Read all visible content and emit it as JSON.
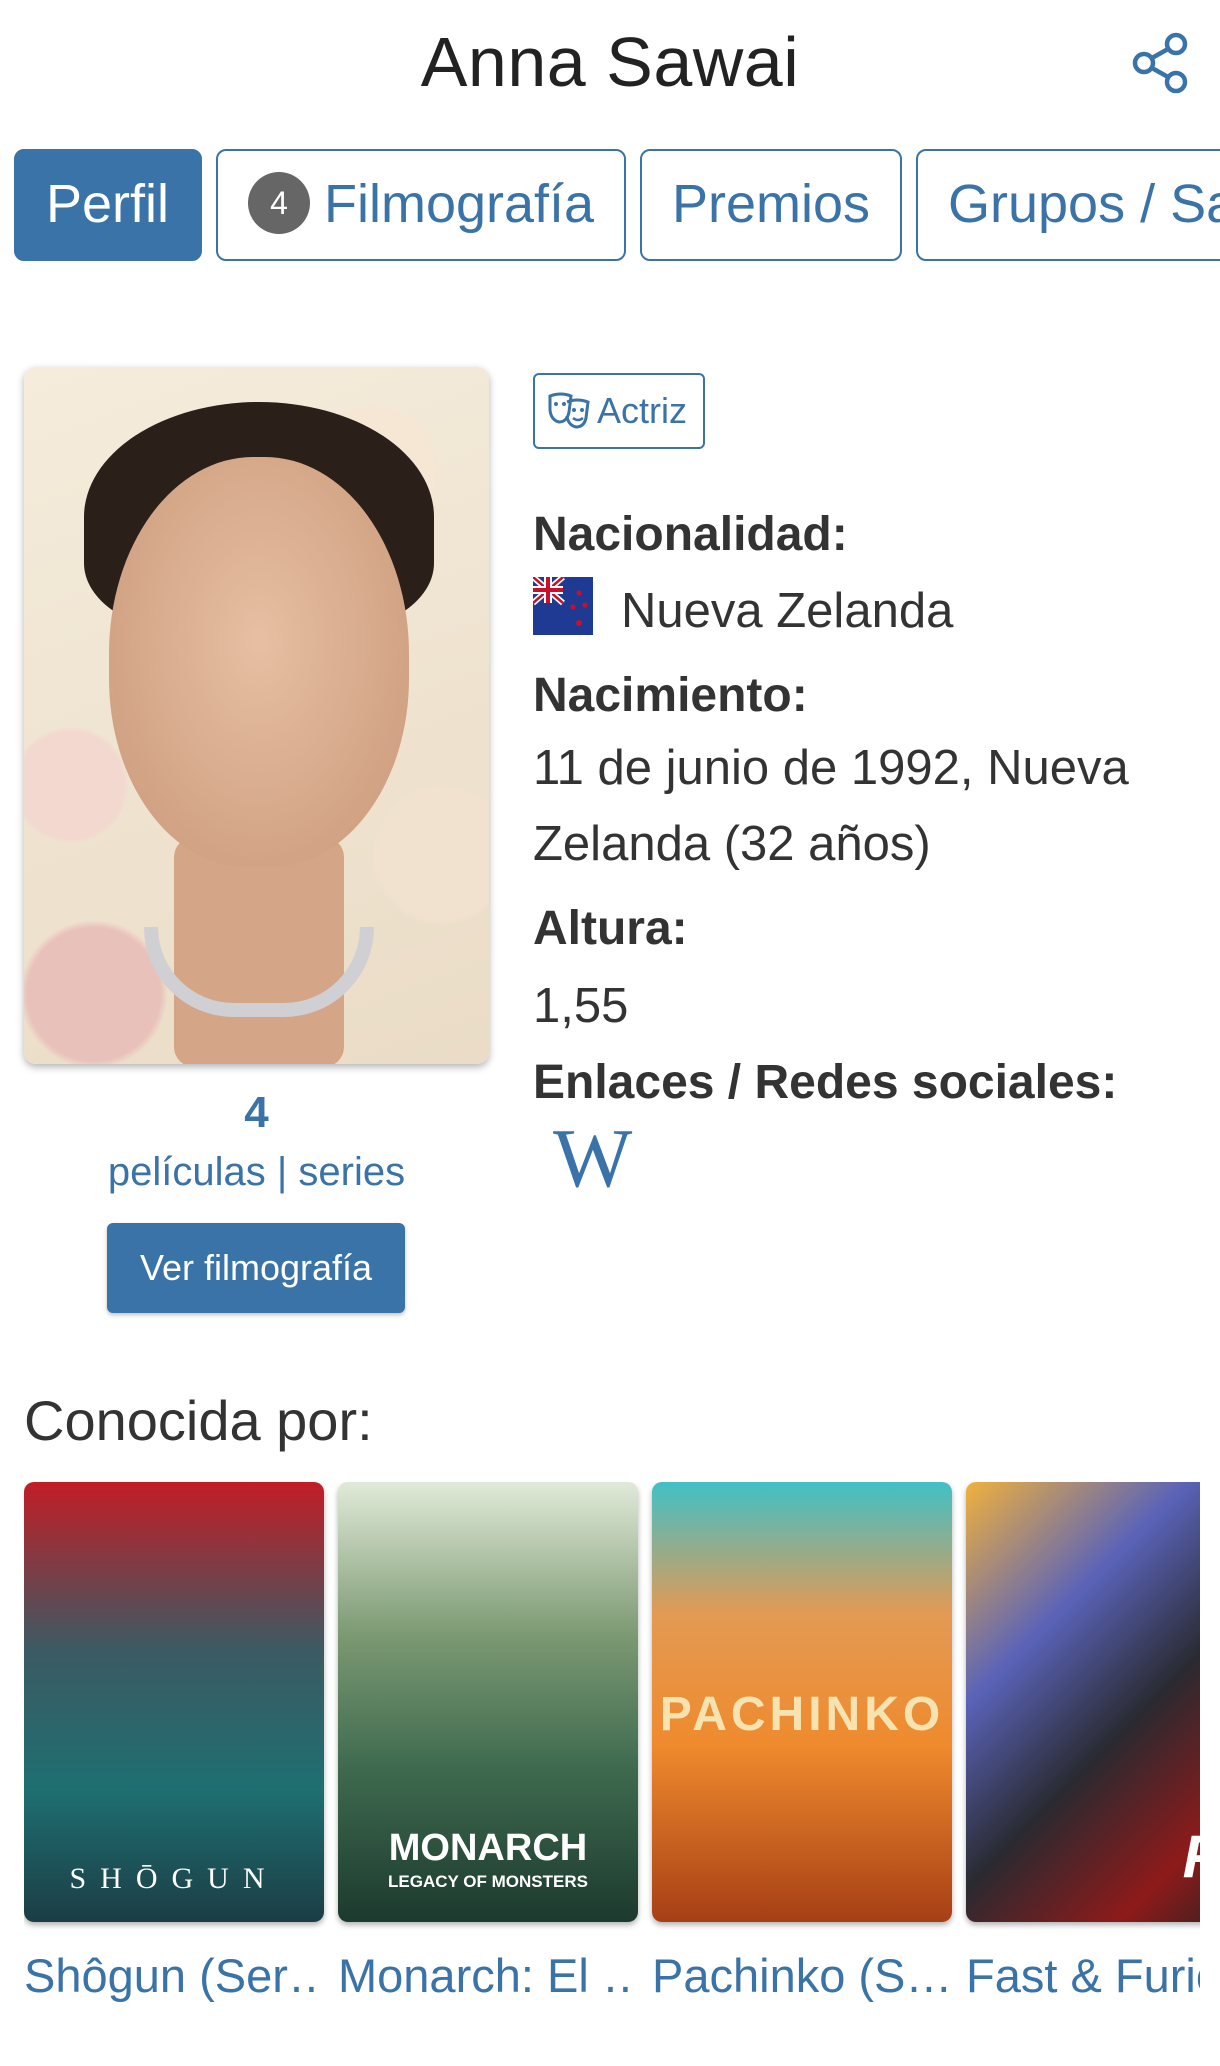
{
  "header": {
    "title": "Anna Sawai",
    "share_icon": "share-icon"
  },
  "tabs": [
    {
      "label": "Perfil",
      "active": true
    },
    {
      "label": "Filmografía",
      "count": "4"
    },
    {
      "label": "Premios"
    },
    {
      "label": "Grupos / Sa"
    }
  ],
  "profile": {
    "photo_alt": "Anna Sawai",
    "film_count": "4",
    "film_links": "películas | series",
    "view_button": "Ver filmografía"
  },
  "info": {
    "role_badge": "Actriz",
    "nationality_label": "Nacionalidad:",
    "nationality_value": "Nueva Zelanda",
    "birth_label": "Nacimiento:",
    "birth_value": "11 de junio de 1992, Nueva Zelanda (32 años)",
    "height_label": "Altura:",
    "height_value": "1,55",
    "links_label": "Enlaces / Redes sociales:",
    "wiki_glyph": "W"
  },
  "known_for": {
    "title": "Conocida por:",
    "items": [
      {
        "title": "Shôgun (Ser…",
        "poster_text": "SHŌGUN"
      },
      {
        "title": "Monarch: El …",
        "poster_text": "MONARCH",
        "poster_sub": "LEGACY OF MONSTERS"
      },
      {
        "title": "Pachinko (S…",
        "poster_text": "PACHINKO"
      },
      {
        "title": "Fast & Furio",
        "poster_text": "F"
      }
    ]
  },
  "colors": {
    "accent": "#3a73a8",
    "text": "#333333"
  }
}
